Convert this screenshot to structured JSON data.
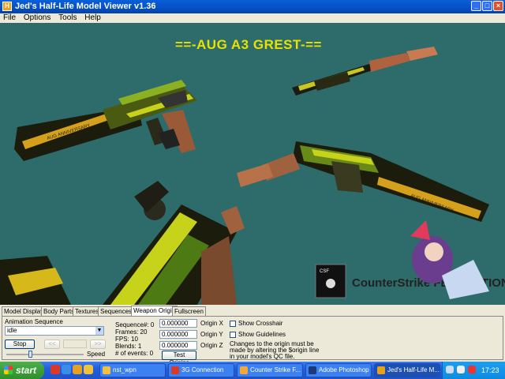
{
  "window": {
    "title": "Jed's Half-Life Model Viewer v1.36",
    "buttons": {
      "minimize": "_",
      "maximize": "□",
      "close": "×"
    }
  },
  "menu": [
    "File",
    "Options",
    "Tools",
    "Help"
  ],
  "viewport": {
    "model_title": "==-AUG A3 GREST-==",
    "background_color": "#2e6b6b",
    "logo_text": "CounterStrike FEDERATION",
    "weapon_marking": "AUG ANNIVERSARY"
  },
  "tabs": [
    "Model Display",
    "Body Parts",
    "Textures",
    "Sequences",
    "Weapon Origin",
    "Fullscreen"
  ],
  "active_tab": "Weapon Origin",
  "animation": {
    "label": "Animation Sequence",
    "sequence": "idle",
    "stop": "Stop",
    "prev": "<<",
    "next": ">>",
    "speed_label": "Speed",
    "speed_value": 0.3
  },
  "info": {
    "sequence": "Sequence#: 0",
    "frames": "Frames: 20",
    "fps": "FPS: 10",
    "blends": "Blends: 1",
    "events": "# of events: 0"
  },
  "origin": {
    "x": "0.000000",
    "y": "0.000000",
    "z": "0.000000",
    "x_label": "Origin X",
    "y_label": "Origin Y",
    "z_label": "Origin Z",
    "test_button": "Test Origins"
  },
  "options": {
    "crosshair": "Show Crosshair",
    "guidelines": "Show Guidelines",
    "note": [
      "Changes to the origin must be",
      "made by altering the $origin line",
      "in your model's QC file."
    ]
  },
  "taskbar": {
    "start": "start",
    "tasks": [
      "nst_wpn",
      "3G Connection",
      "Counter Strike F...",
      "Adobe Photoshop",
      "Jed's Half-Life M..."
    ],
    "active_task": 4,
    "clock": "17:23"
  }
}
